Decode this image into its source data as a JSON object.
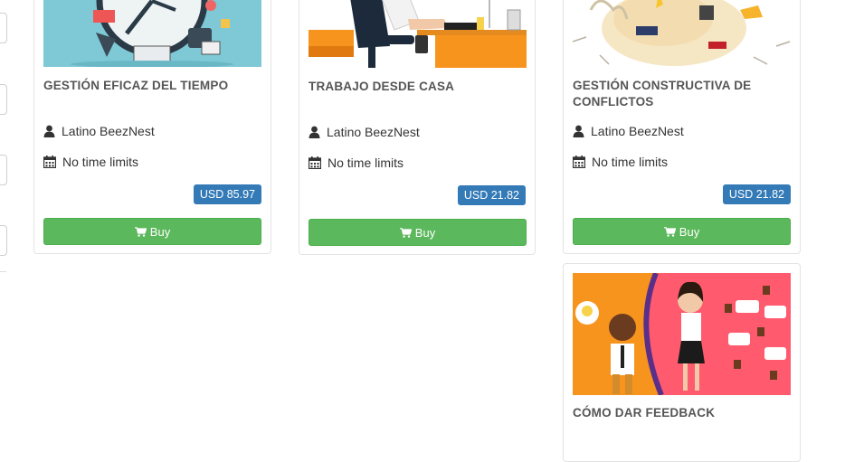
{
  "courses": [
    {
      "title": "GESTIÓN EFICAZ DEL TIEMPO",
      "author": "Latino BeezNest",
      "duration": "No time limits",
      "price": "USD 85.97",
      "buy_label": "Buy"
    },
    {
      "title": "TRABAJO DESDE CASA",
      "author": "Latino BeezNest",
      "duration": "No time limits",
      "price": "USD 21.82",
      "buy_label": "Buy"
    },
    {
      "title": "GESTIÓN CONSTRUCTIVA DE CONFLICTOS",
      "author": "Latino BeezNest",
      "duration": "No time limits",
      "price": "USD 21.82",
      "buy_label": "Buy"
    },
    {
      "title": "CÓMO DAR FEEDBACK"
    }
  ],
  "colors": {
    "price_badge": "#337ab7",
    "buy_button": "#5cb85c",
    "card_border": "#e3e3e3",
    "title_text": "#555555"
  },
  "icons": {
    "author": "user-icon",
    "duration": "calendar-icon",
    "buy": "shopping-cart-icon"
  }
}
